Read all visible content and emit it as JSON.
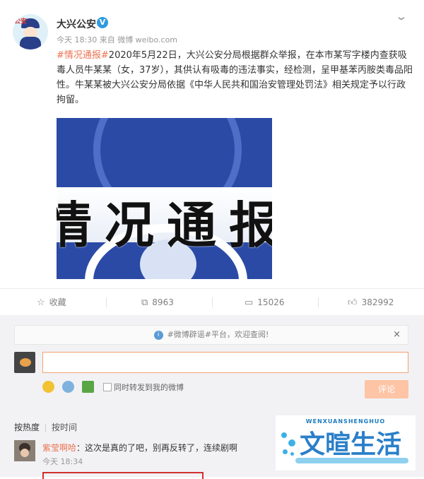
{
  "post": {
    "author": "大兴公安",
    "verified_badge": "V",
    "time_source": "今天 18:30 来自 微博 weibo.com",
    "hashtag": "#情况通报#",
    "body": "2020年5月22日，大兴公安分局根据群众举报，在本市某写字楼内查获吸毒人员牛某某（女，37岁），其供认有吸毒的违法事实，经检测，呈甲基苯丙胺类毒品阳性。牛某某被大兴公安分局依据《中华人民共和国治安管理处罚法》相关规定予以行政拘留。",
    "image_text": "情况通报",
    "avatar_text": "公安"
  },
  "actions": {
    "favorite": "收藏",
    "repost_count": "8963",
    "comment_count": "15026",
    "like_count": "382992"
  },
  "notice": {
    "text": "#微博辟谣#平台，欢迎查阅!",
    "close": "×"
  },
  "composer": {
    "input_value": "",
    "forward_label": "同时转发到我的微博",
    "submit_label": "评论"
  },
  "sort": {
    "by_hot": "按热度",
    "by_time": "按时间"
  },
  "comments": [
    {
      "user": "紫莹啊哈",
      "text": "：这次是真的了吧，别再反转了，连续剧啊",
      "time": "今天 18:34"
    }
  ],
  "watermark": {
    "small": "WENXUANSHENGHUO",
    "big": "文暄生活"
  },
  "colors": {
    "accent_orange": "#eb7350",
    "verified_blue": "#2f9ae0",
    "submit_disabled": "#fdc4a5"
  }
}
